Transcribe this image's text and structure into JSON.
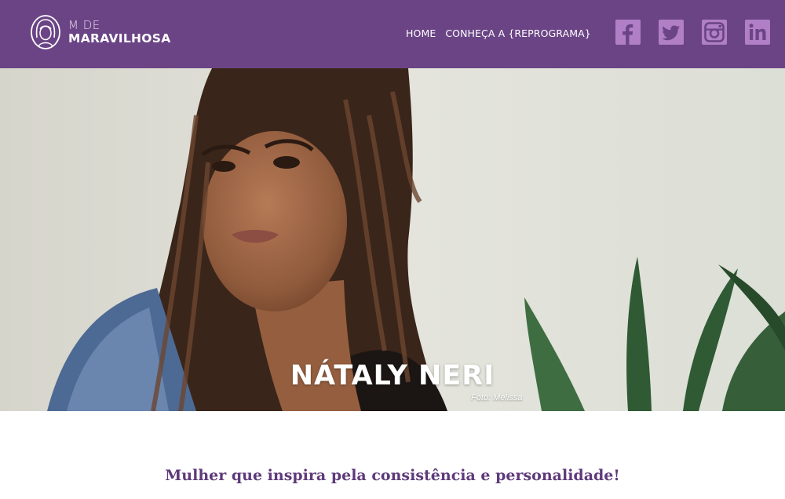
{
  "header": {
    "logo": {
      "line1": "M DE",
      "line2": "MARAVILHOSA"
    },
    "nav": [
      {
        "label": "HOME"
      },
      {
        "label": "CONHEÇA A {REPROGRAMA}"
      }
    ],
    "social": [
      {
        "icon": "facebook-icon"
      },
      {
        "icon": "twitter-icon"
      },
      {
        "icon": "instagram-icon"
      },
      {
        "icon": "linkedin-icon"
      }
    ]
  },
  "hero": {
    "name": "NÁTALY NERI",
    "photo_credit": "Foto: Melissa"
  },
  "intro": {
    "tagline": "Mulher que inspira pela consistência e personalidade!"
  },
  "colors": {
    "header_bg": "#6b4486",
    "social_bg": "#b17fc6",
    "tagline": "#5e3a7a"
  }
}
